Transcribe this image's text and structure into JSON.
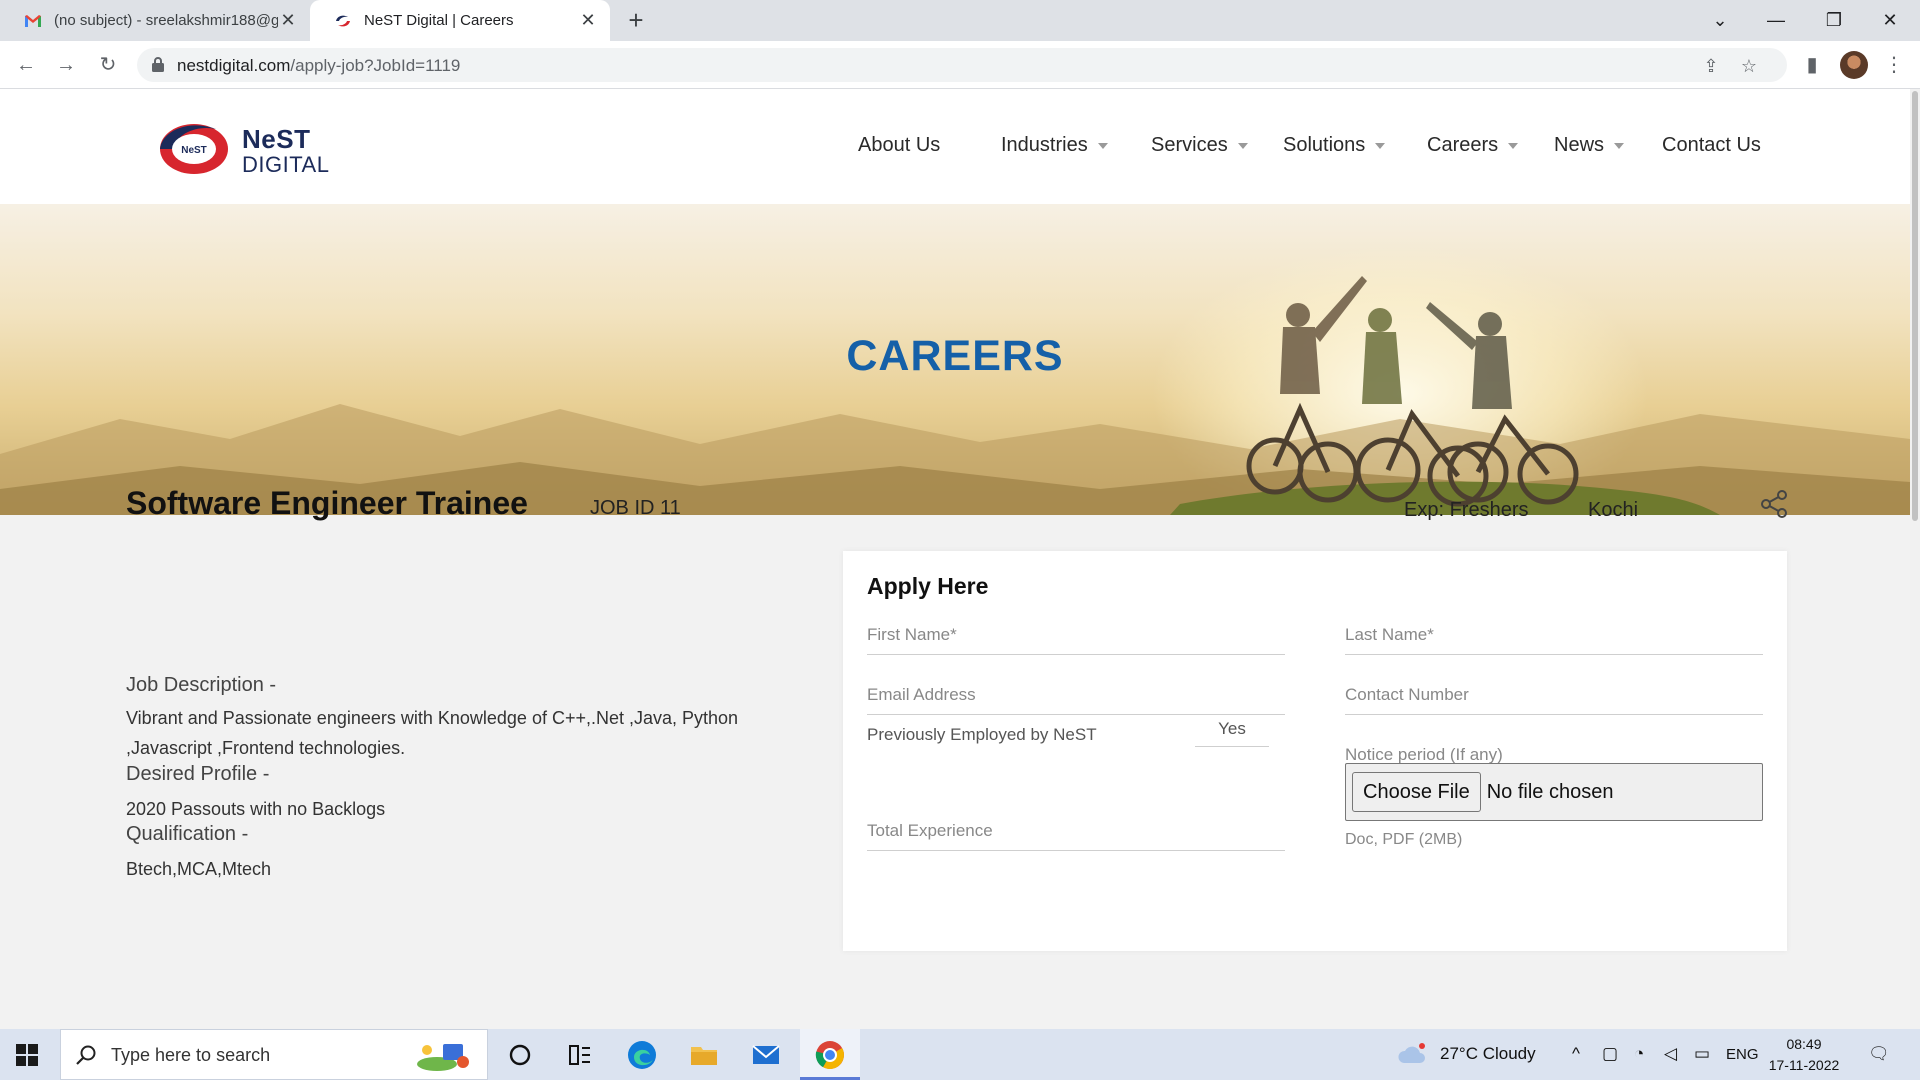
{
  "browser": {
    "tabs": [
      {
        "title": "(no subject) - sreelakshmir188@g",
        "active": false,
        "favicon": "gmail-icon"
      },
      {
        "title": "NeST Digital | Careers",
        "active": true,
        "favicon": "nest-icon"
      }
    ],
    "url_host": "nestdigital.com",
    "url_path": "/apply-job?JobId=1119"
  },
  "site": {
    "logo_line1": "NeST",
    "logo_line2": "DIGITAL",
    "logo_badge": "NeST",
    "nav": [
      {
        "label": "About Us",
        "dropdown": false
      },
      {
        "label": "Industries",
        "dropdown": true
      },
      {
        "label": "Services",
        "dropdown": true
      },
      {
        "label": "Solutions",
        "dropdown": true
      },
      {
        "label": "Careers",
        "dropdown": true
      },
      {
        "label": "News",
        "dropdown": true
      },
      {
        "label": "Contact Us",
        "dropdown": false
      }
    ],
    "hero_title": "CAREERS"
  },
  "job": {
    "title": "Software Engineer Trainee",
    "id_label": "JOB ID 11",
    "experience": "Exp: Freshers",
    "location": "Kochi",
    "sections": [
      {
        "heading": "Job Description -",
        "text": "Vibrant and Passionate engineers with Knowledge of C++,.Net ,Java, Python ,Javascript ,Frontend technologies."
      },
      {
        "heading": "Desired Profile -",
        "text": "2020 Passouts with no Backlogs"
      },
      {
        "heading": "Qualification -",
        "text": "Btech,MCA,Mtech"
      }
    ]
  },
  "form": {
    "title": "Apply Here",
    "first_name": "First Name*",
    "last_name": "Last Name*",
    "email": "Email Address",
    "contact": "Contact Number",
    "prev_employed_label": "Previously Employed by NeST",
    "prev_employed_value": "Yes",
    "notice_period": "Notice period (If any)",
    "total_experience": "Total Experience",
    "file_button": "Choose File",
    "file_status": "No file chosen",
    "file_note": "Doc, PDF (2MB)"
  },
  "taskbar": {
    "search_placeholder": "Type here to search",
    "weather": "27°C  Cloudy",
    "language": "ENG",
    "time": "08:49",
    "date": "17-11-2022"
  }
}
